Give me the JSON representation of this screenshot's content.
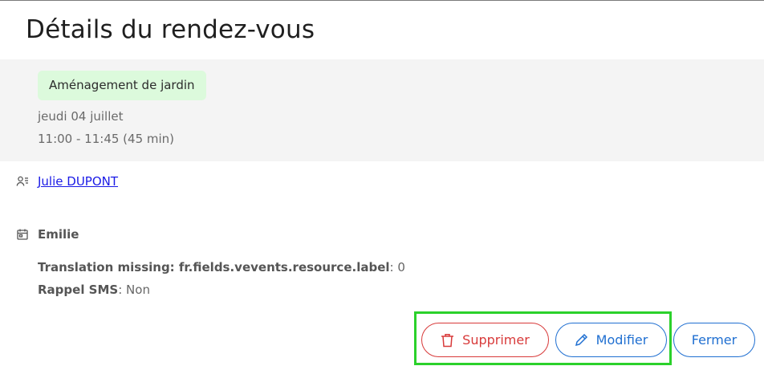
{
  "modal": {
    "title": "Détails du rendez-vous"
  },
  "appointment": {
    "service_tag": "Aménagement de jardin",
    "service_tag_color": "#dcfadc",
    "date": "jeudi 04 juillet",
    "time_range": "11:00 - 11:45 (45 min)"
  },
  "client": {
    "icon": "user-list-icon",
    "name": "Julie DUPONT"
  },
  "resource": {
    "icon": "calendar-icon",
    "name": "Emilie"
  },
  "fields": [
    {
      "label": "Translation missing: fr.fields.vevents.resource.label",
      "value": "0"
    },
    {
      "label": "Rappel SMS",
      "value": "Non"
    }
  ],
  "actions": {
    "delete_label": "Supprimer",
    "delete_icon": "trash-icon",
    "edit_label": "Modifier",
    "edit_icon": "pencil-icon",
    "close_label": "Fermer",
    "danger_color": "#d83a3a",
    "primary_color": "#1f6fd1",
    "highlight_color": "#2bd12b"
  }
}
